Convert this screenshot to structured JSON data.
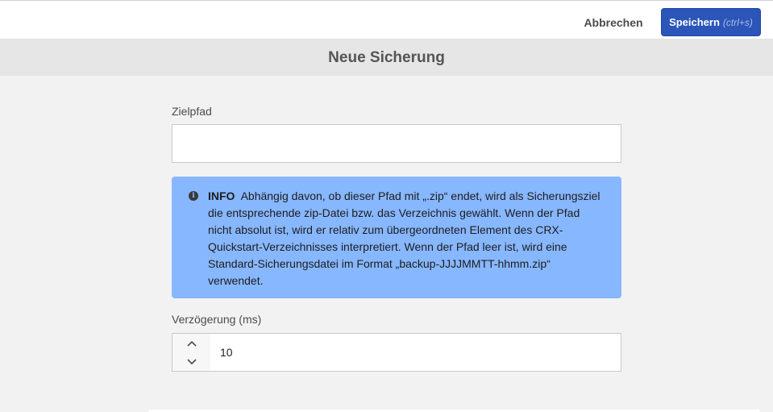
{
  "toolbar": {
    "cancel_label": "Abbrechen",
    "save_label": "Speichern",
    "save_shortcut": "(ctrl+s)",
    "accent_color": "#2b55b8"
  },
  "dialog": {
    "title": "Neue Sicherung"
  },
  "form": {
    "target_path": {
      "label": "Zielpfad",
      "value": ""
    },
    "info": {
      "icon": "info-icon",
      "title": "INFO",
      "text": "Abhängig davon, ob dieser Pfad mit „.zip“ endet, wird als Sicherungsziel die entsprechende zip-Datei bzw. das Verzeichnis gewählt. Wenn der Pfad nicht absolut ist, wird er relativ zum übergeordneten Element des CRX-Quickstart-Verzeichnisses interpretiert. Wenn der Pfad leer ist, wird eine Standard-Sicherungsdatei im Format „backup-JJJJMMTT-hhmm.zip“ verwendet.",
      "background_color": "#87b7ff"
    },
    "delay": {
      "label": "Verzögerung (ms)",
      "value": "10",
      "increment_icon": "chevron-up-icon",
      "decrement_icon": "chevron-down-icon"
    }
  }
}
